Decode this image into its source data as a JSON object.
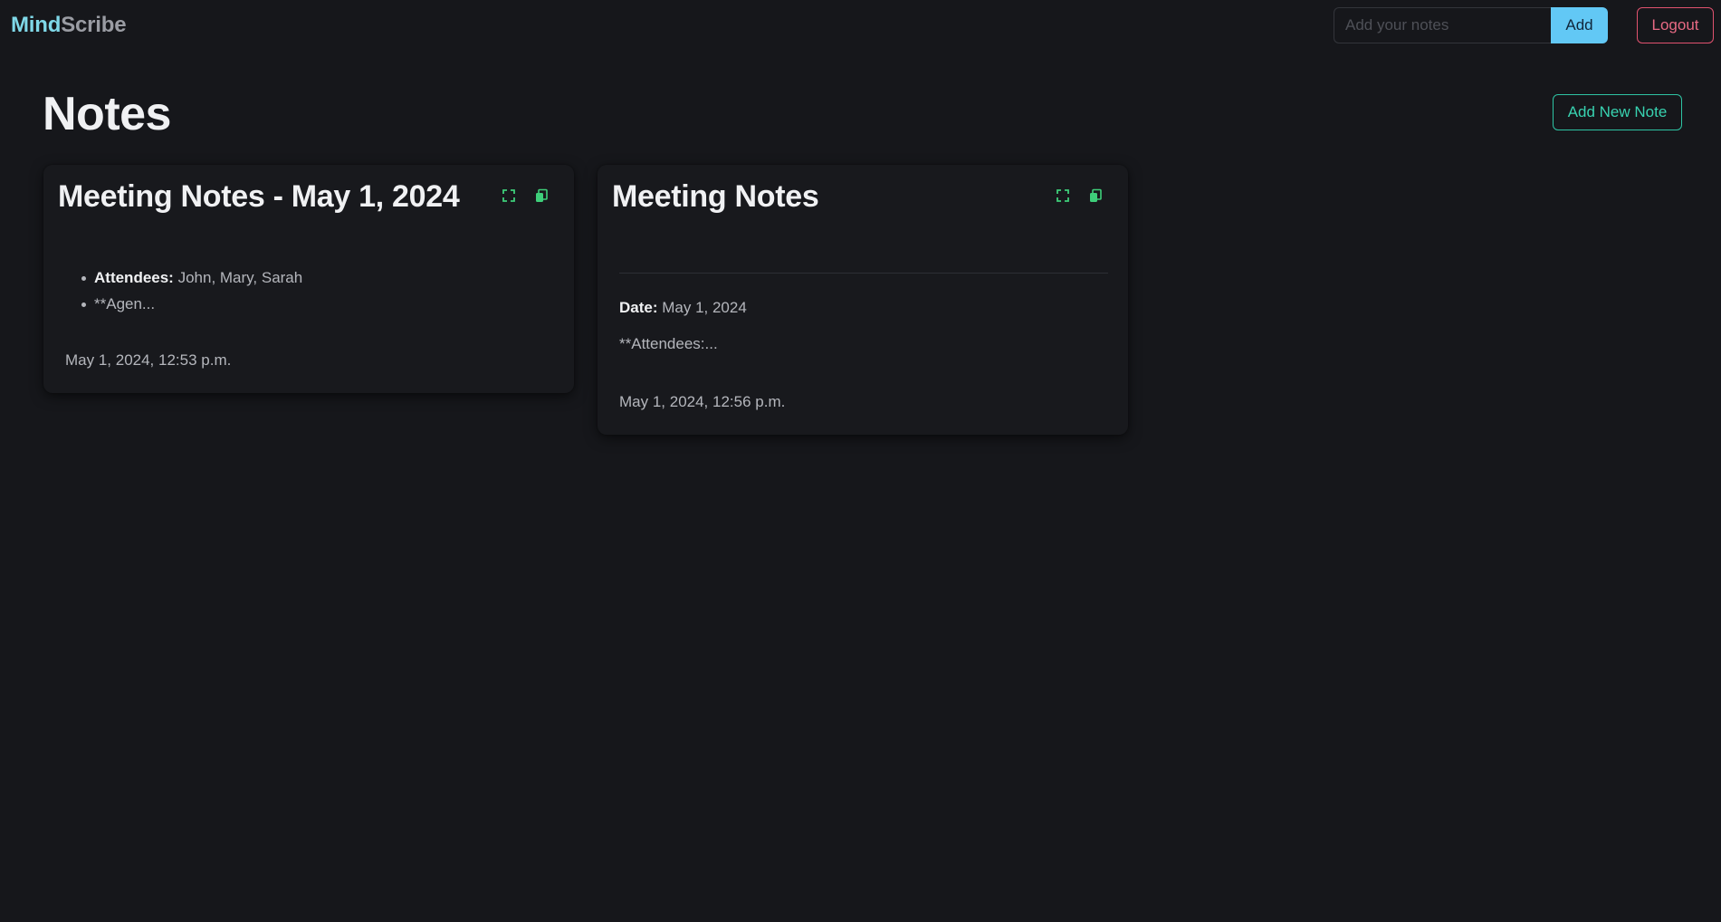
{
  "brand": {
    "part1": "Mind",
    "part2": "Scribe"
  },
  "quick_add": {
    "placeholder": "Add your notes",
    "value": "",
    "button_label": "Add"
  },
  "header": {
    "logout_label": "Logout"
  },
  "page": {
    "title": "Notes",
    "add_new_label": "Add New Note"
  },
  "notes": [
    {
      "title": "Meeting Notes - May 1, 2024",
      "bullets": [
        {
          "label": "Attendees:",
          "text": " John, Mary, Sarah"
        },
        {
          "label": "",
          "text": "**Agen..."
        }
      ],
      "timestamp": "May 1, 2024, 12:53 p.m."
    },
    {
      "title": "Meeting Notes",
      "date_label": "Date:",
      "date_value": " May 1, 2024",
      "attendees_text": "**Attendees:...",
      "timestamp": "May 1, 2024, 12:56 p.m."
    }
  ],
  "icons": {
    "expand": "expand-icon",
    "copy": "copy-icon"
  },
  "colors": {
    "background": "#16171b",
    "brand_accent": "#7fd8e8",
    "add_button": "#62c8f5",
    "logout": "#e0526f",
    "add_new_note": "#2ec4a4",
    "card_icons": "#3ecf7a"
  }
}
